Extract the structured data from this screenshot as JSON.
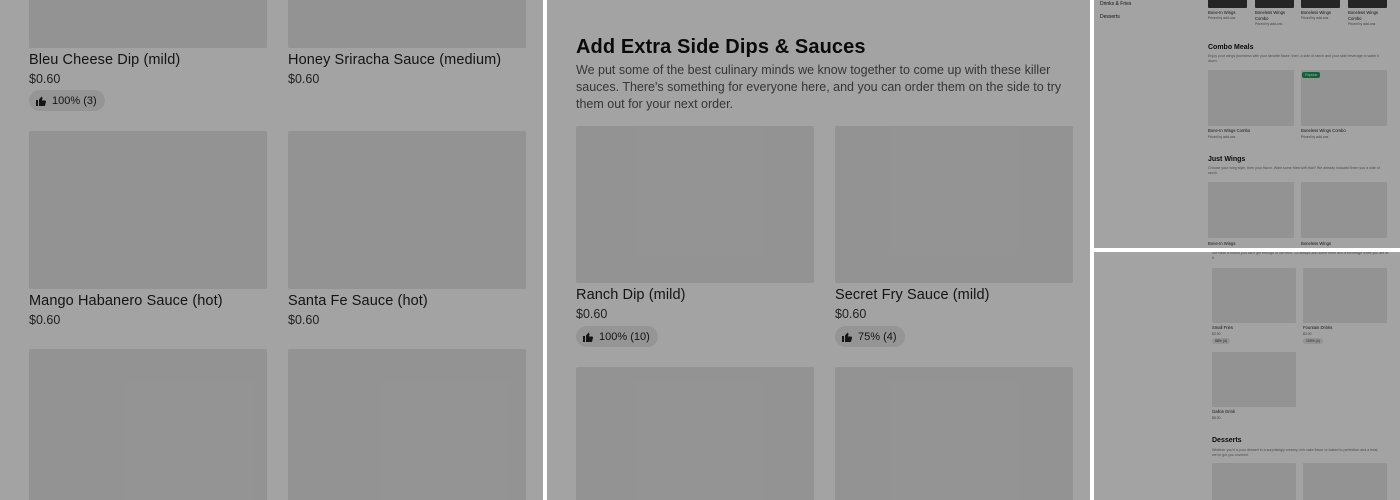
{
  "panel_a": {
    "items": [
      {
        "name": "Bleu Cheese Dip (mild)",
        "price": "$0.60",
        "rating": "100% (3)"
      },
      {
        "name": "Honey Sriracha Sauce (medium)",
        "price": "$0.60",
        "rating": ""
      },
      {
        "name": "Mango Habanero Sauce (hot)",
        "price": "$0.60",
        "rating": ""
      },
      {
        "name": "Santa Fe Sauce (hot)",
        "price": "$0.60",
        "rating": ""
      }
    ]
  },
  "panel_b": {
    "title": "Add Extra Side Dips & Sauces",
    "description": "We put some of the best culinary minds we know together to come up with these killer sauces. There's something for everyone here, and you can order them on the side to try them out for your next order.",
    "items": [
      {
        "name": "Ranch Dip (mild)",
        "price": "$0.60",
        "rating": "100% (10)"
      },
      {
        "name": "Secret Fry Sauce (mild)",
        "price": "$0.60",
        "rating": "75% (4)"
      }
    ]
  },
  "panel_c": {
    "sidebar": [
      "Drinks & Fries",
      "Desserts"
    ],
    "top_items": [
      {
        "name": "Bone-In Wings",
        "sub": "Priced by add-ons"
      },
      {
        "name": "Boneless Wings Combo",
        "sub": "Priced by add-ons"
      },
      {
        "name": "Boneless Wings",
        "sub": "Priced by add-ons"
      },
      {
        "name": "Boneless Wings Combo",
        "sub": "Priced by add-ons"
      }
    ],
    "combo": {
      "title": "Combo Meals",
      "desc": "Enjoy your wings (boneless with your favorite flavor, then, a side of ranch and your side beverage to wash it down.",
      "badge": "Popular",
      "items": [
        {
          "name": "Bone-In Wings Combo",
          "sub": "Priced by add-ons"
        },
        {
          "name": "Boneless Wings Combo",
          "sub": "Priced by add-ons"
        }
      ]
    },
    "just_wings": {
      "title": "Just Wings",
      "desc": "Choose your wing style, then your flavor. Want some fries with that? We already included them you a side of ranch.",
      "items": [
        {
          "name": "Bone-In Wings"
        },
        {
          "name": "Boneless Wings"
        }
      ]
    }
  },
  "panel_d": {
    "intro": "We have a hunch you can't get enough of our fries. So always add some them and a beverage while you are at it.",
    "items": [
      {
        "name": "Small Fries",
        "price": "$3.00",
        "rating": "88% (4)"
      },
      {
        "name": "Fountain Drinks",
        "price": "$3.00",
        "rating": "100% (4)"
      },
      {
        "name": "Gallon Drink",
        "price": "$8.00",
        "rating": ""
      }
    ],
    "desserts": {
      "title": "Desserts",
      "desc": "Whether you'd a your dessert in a surprisingly creamy, rich cake flavor or baked to perfection and a treat, we've got you covered."
    }
  },
  "colors": {
    "overlay": "rgba(0,0,0,0.36)",
    "popular_badge": "#1f9a57"
  }
}
